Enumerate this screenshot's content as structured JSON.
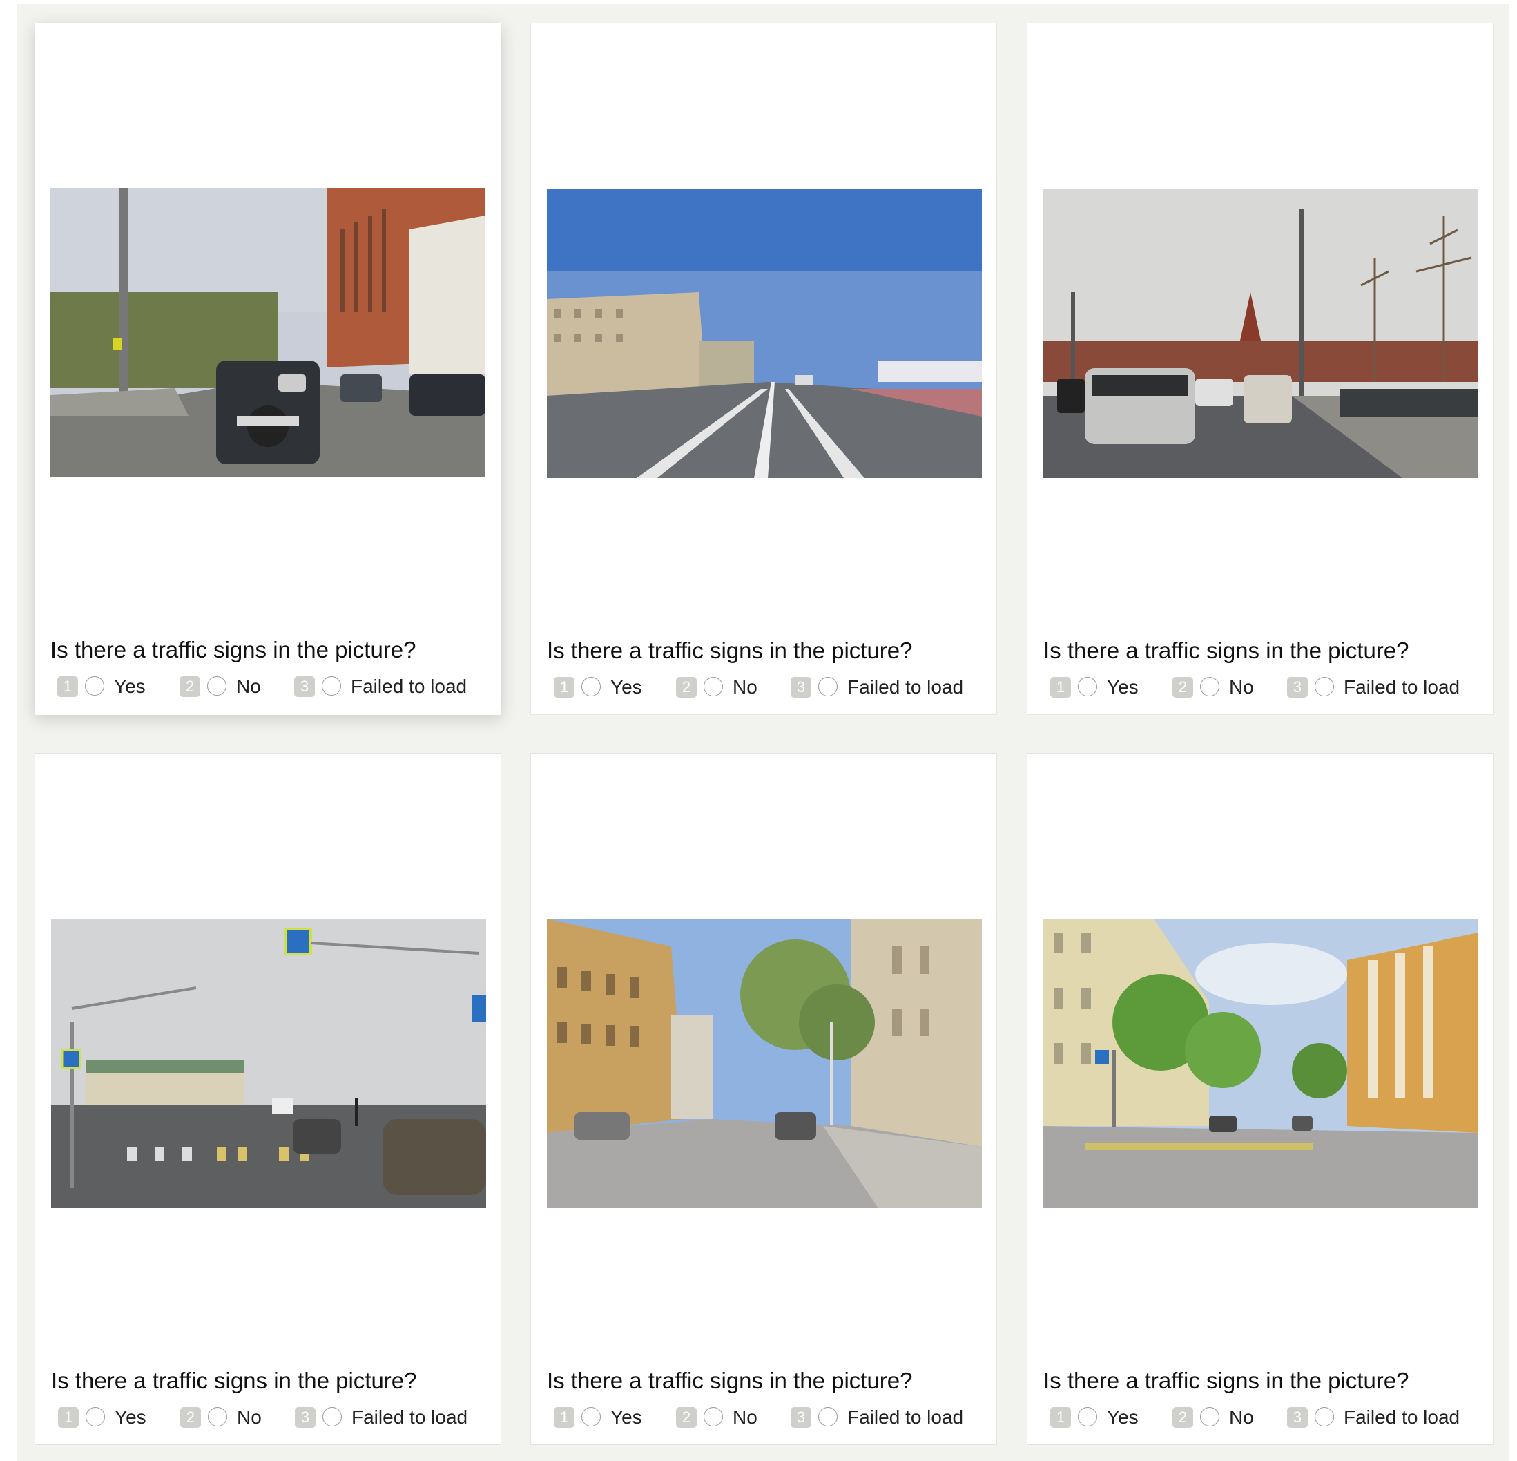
{
  "question": "Is there a traffic signs in the picture?",
  "options": [
    {
      "hotkey": "1",
      "label": "Yes"
    },
    {
      "hotkey": "2",
      "label": "No"
    },
    {
      "hotkey": "3",
      "label": "Failed to load"
    }
  ],
  "cards": [
    {
      "image": "street-brick-building-suv-photo"
    },
    {
      "image": "wide-avenue-blue-sky-photo"
    },
    {
      "image": "kremlin-embankment-traffic-photo"
    },
    {
      "image": "intersection-pedestrian-crossing-signs-photo"
    },
    {
      "image": "tree-lined-street-buildings-photo"
    },
    {
      "image": "yellow-buildings-crosswalk-photo"
    }
  ],
  "colors": {
    "panel_background": "#f2f2ee",
    "card_background": "#ffffff",
    "hotkey_badge": "#cfcfcc"
  }
}
